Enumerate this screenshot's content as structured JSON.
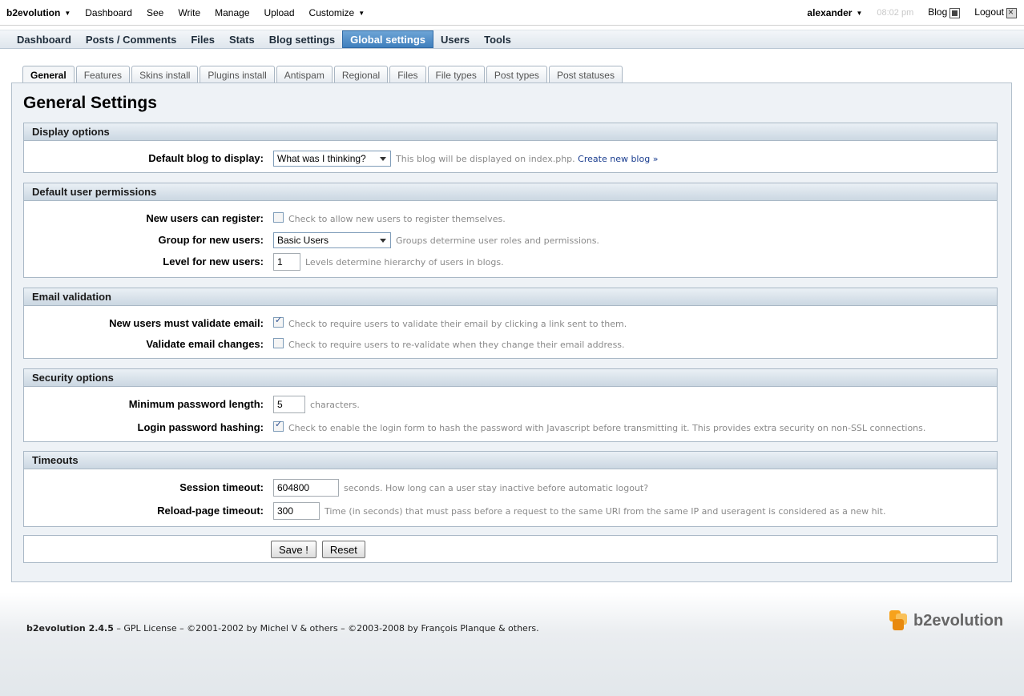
{
  "evobar": {
    "brand": "b2evolution",
    "menu": [
      "Dashboard",
      "See",
      "Write",
      "Manage",
      "Upload",
      "Customize"
    ],
    "user": "alexander",
    "time": "08:02 pm",
    "blog": "Blog",
    "logout": "Logout"
  },
  "mainmenu": [
    "Dashboard",
    "Posts / Comments",
    "Files",
    "Stats",
    "Blog settings",
    "Global settings",
    "Users",
    "Tools"
  ],
  "tabs": [
    "General",
    "Features",
    "Skins install",
    "Plugins install",
    "Antispam",
    "Regional",
    "Files",
    "File types",
    "Post types",
    "Post statuses"
  ],
  "page_title": "General Settings",
  "display_options": {
    "title": "Display options",
    "default_blog_label": "Default blog to display:",
    "default_blog_value": "What was I thinking?",
    "default_blog_note": "This blog will be displayed on index.php.",
    "create_link": "Create new blog »"
  },
  "permissions": {
    "title": "Default user permissions",
    "register_label": "New users can register:",
    "register_checked": false,
    "register_note": "Check to allow new users to register themselves.",
    "group_label": "Group for new users:",
    "group_value": "Basic Users",
    "group_note": "Groups determine user roles and permissions.",
    "level_label": "Level for new users:",
    "level_value": "1",
    "level_note": "Levels determine hierarchy of users in blogs."
  },
  "email": {
    "title": "Email validation",
    "validate_label": "New users must validate email:",
    "validate_checked": true,
    "validate_note": "Check to require users to validate their email by clicking a link sent to them.",
    "changes_label": "Validate email changes:",
    "changes_checked": false,
    "changes_note": "Check to require users to re-validate when they change their email address."
  },
  "security": {
    "title": "Security options",
    "minpass_label": "Minimum password length:",
    "minpass_value": "5",
    "minpass_note": "characters.",
    "hash_label": "Login password hashing:",
    "hash_checked": true,
    "hash_note": "Check to enable the login form to hash the password with Javascript before transmitting it. This provides extra security on non-SSL connections."
  },
  "timeouts": {
    "title": "Timeouts",
    "session_label": "Session timeout:",
    "session_value": "604800",
    "session_note": "seconds. How long can a user stay inactive before automatic logout?",
    "reload_label": "Reload-page timeout:",
    "reload_value": "300",
    "reload_note": "Time (in seconds) that must pass before a request to the same URI from the same IP and useragent is considered as a new hit."
  },
  "buttons": {
    "save": "Save !",
    "reset": "Reset"
  },
  "footer": {
    "version": "b2evolution 2.4.5",
    "rest": " – GPL License – ©2001-2002 by Michel V & others – ©2003-2008 by François Planque & others.",
    "logo_text": "b2evolution"
  },
  "colors": {
    "accent": "#3f7fbd",
    "panel": "#eef2f6",
    "logo_orange": "#f7a21b"
  }
}
